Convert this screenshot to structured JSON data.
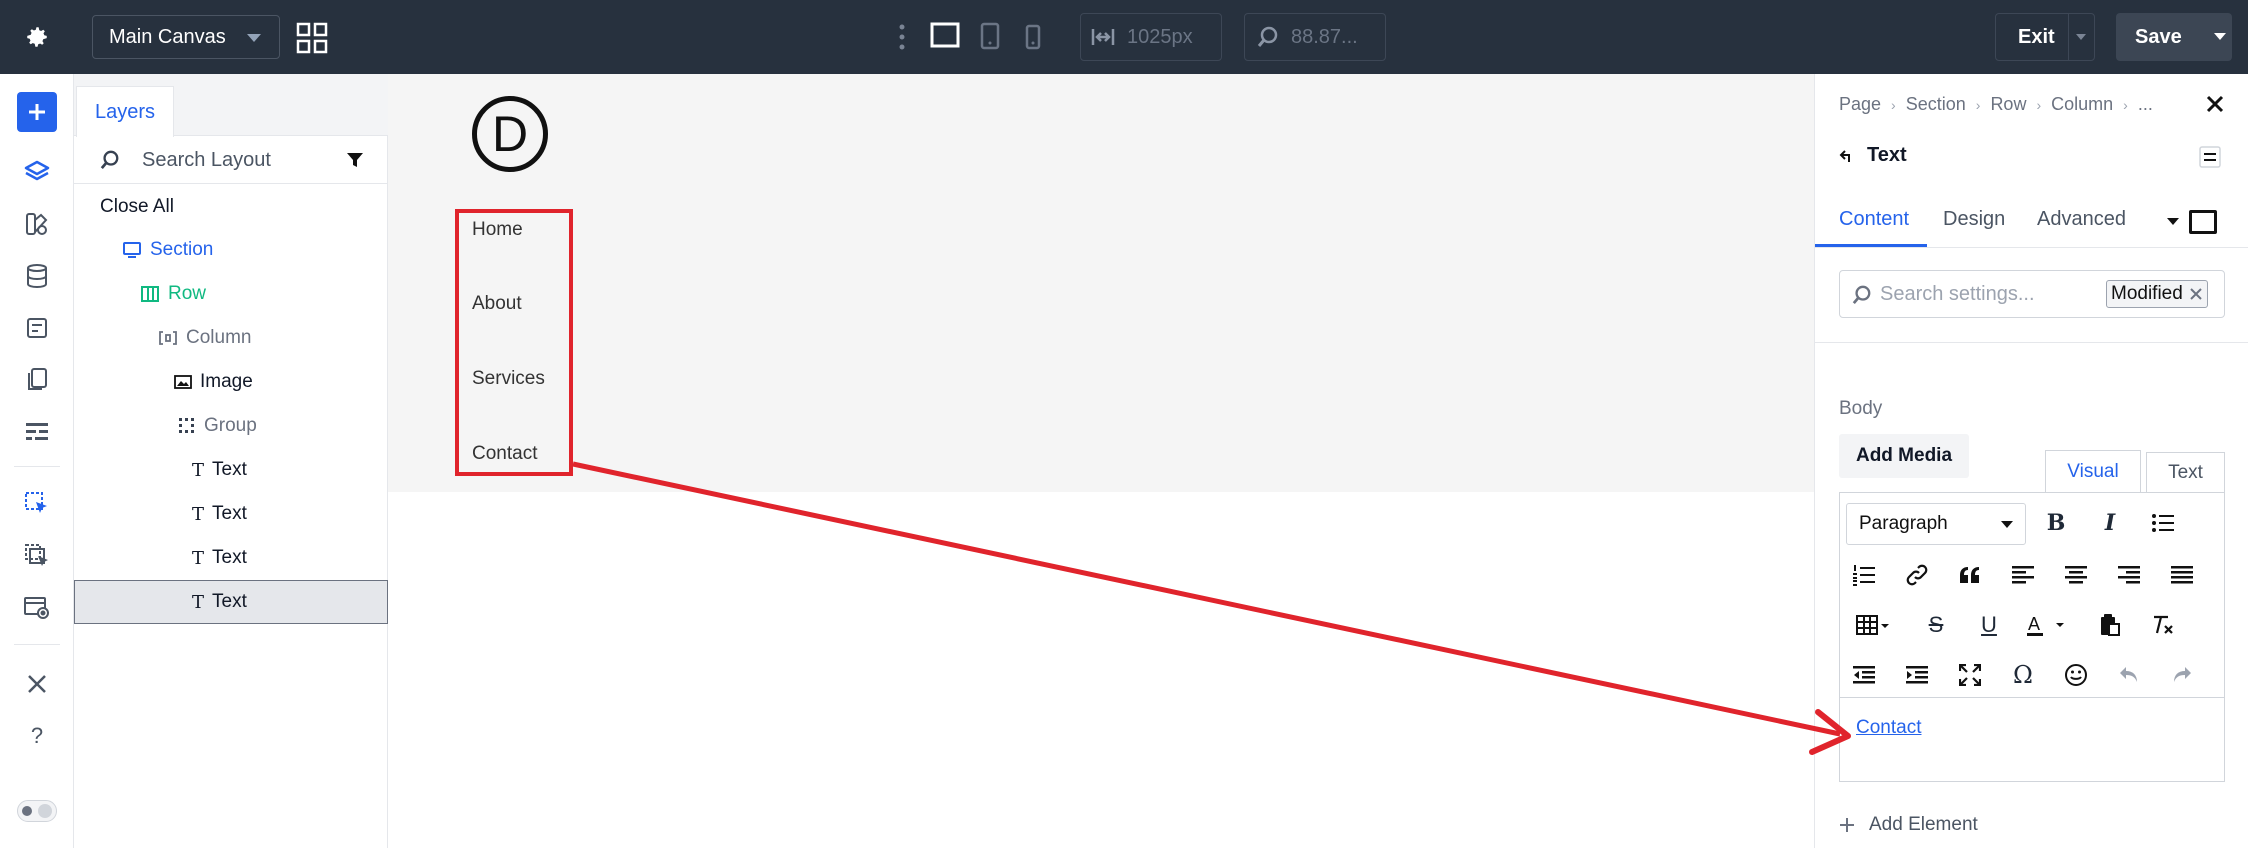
{
  "topbar": {
    "canvas_select": "Main Canvas",
    "width_value": "1025px",
    "zoom_value": "88.87...",
    "exit_label": "Exit",
    "save_label": "Save"
  },
  "layers": {
    "tab_label": "Layers",
    "search_placeholder": "Search Layout",
    "close_all": "Close All",
    "items": [
      {
        "label": "Section",
        "icon": "section-icon"
      },
      {
        "label": "Row",
        "icon": "row-icon"
      },
      {
        "label": "Column",
        "icon": "column-icon"
      },
      {
        "label": "Image",
        "icon": "image-icon"
      },
      {
        "label": "Group",
        "icon": "group-icon"
      },
      {
        "label": "Text",
        "icon": "text-icon"
      },
      {
        "label": "Text",
        "icon": "text-icon"
      },
      {
        "label": "Text",
        "icon": "text-icon"
      },
      {
        "label": "Text",
        "icon": "text-icon"
      }
    ]
  },
  "canvas": {
    "logo_letter": "D",
    "menu": [
      "Home",
      "About",
      "Services",
      "Contact"
    ]
  },
  "panel": {
    "breadcrumb": [
      "Page",
      "Section",
      "Row",
      "Column",
      "..."
    ],
    "title": "Text",
    "tabs": [
      "Content",
      "Design",
      "Advanced"
    ],
    "active_tab": "Content",
    "search_placeholder": "Search settings...",
    "modified_badge": "Modified",
    "body_label": "Body",
    "add_media": "Add Media",
    "editor_tabs": [
      "Visual",
      "Text"
    ],
    "paragraph_select": "Paragraph",
    "content_text": "Contact",
    "add_element": "Add Element"
  },
  "colors": {
    "topbar_bg": "#27313e",
    "accent": "#2563eb",
    "highlight_red": "#e0242c",
    "row_green": "#10b981"
  }
}
